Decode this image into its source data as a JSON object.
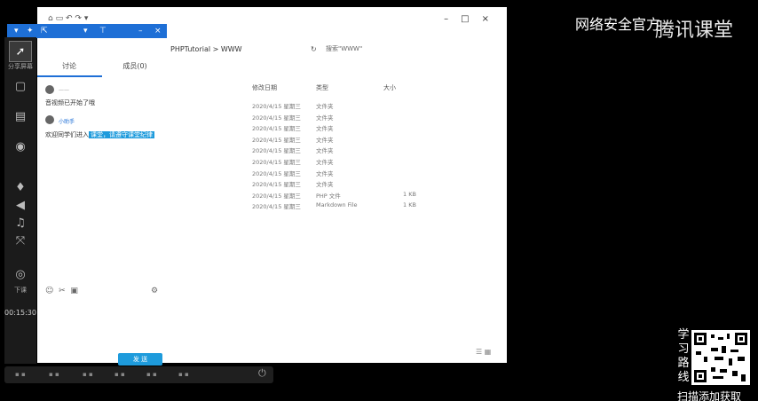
{
  "watermark": {
    "text": "网络安全官方",
    "brand": "腾讯课堂"
  },
  "promo": {
    "vertical_text": [
      "学",
      "习",
      "路",
      "线"
    ],
    "bottom_text": "扫描添加获取"
  },
  "left_bar": {
    "items": [
      {
        "icon": "share-screen-icon",
        "label": "分享屏幕"
      },
      {
        "icon": "camera-icon",
        "label": ""
      },
      {
        "icon": "document-icon",
        "label": ""
      },
      {
        "icon": "video-icon",
        "label": ""
      },
      {
        "icon": "microphone-icon",
        "label": ""
      },
      {
        "icon": "speaker-icon",
        "label": ""
      },
      {
        "icon": "music-icon",
        "label": ""
      },
      {
        "icon": "expand-icon",
        "label": ""
      },
      {
        "icon": "power-icon",
        "label": "下课"
      }
    ],
    "time": "00:15:30"
  },
  "chat": {
    "tabs": [
      "讨论",
      "成员(0)"
    ],
    "messages": [
      {
        "name": "——",
        "text": "音视频已开始了哦"
      },
      {
        "name": "小助手",
        "text": "欢迎同学们进入",
        "highlight": "课堂，请遵守课堂纪律"
      }
    ],
    "send_label": "发 送"
  },
  "explorer": {
    "breadcrumb": "PHPTutorial  >  WWW",
    "search_placeholder": "搜索\"WWW\"",
    "columns": [
      "修改日期",
      "类型",
      "大小"
    ],
    "rows": [
      {
        "date": "2020/4/15 星期三",
        "type": "文件夹",
        "size": ""
      },
      {
        "date": "2020/4/15 星期三",
        "type": "文件夹",
        "size": ""
      },
      {
        "date": "2020/4/15 星期三",
        "type": "文件夹",
        "size": ""
      },
      {
        "date": "2020/4/15 星期三",
        "type": "文件夹",
        "size": ""
      },
      {
        "date": "2020/4/15 星期三",
        "type": "文件夹",
        "size": ""
      },
      {
        "date": "2020/4/15 星期三",
        "type": "文件夹",
        "size": ""
      },
      {
        "date": "2020/4/15 星期三",
        "type": "文件夹",
        "size": ""
      },
      {
        "date": "2020/4/15 星期三",
        "type": "文件夹",
        "size": ""
      },
      {
        "date": "2020/4/15 星期三",
        "type": "PHP 文件",
        "size": "1 KB"
      },
      {
        "date": "2020/4/15 星期三",
        "type": "Markdown File",
        "size": "1 KB"
      }
    ]
  },
  "colors": {
    "accent": "#1e6fd6",
    "highlight": "#1e9bdc"
  }
}
